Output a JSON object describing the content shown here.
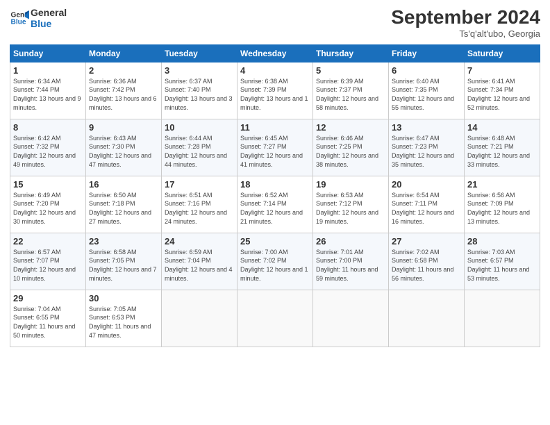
{
  "header": {
    "logo_line1": "General",
    "logo_line2": "Blue",
    "month": "September 2024",
    "location": "Ts'q'alt'ubo, Georgia"
  },
  "weekdays": [
    "Sunday",
    "Monday",
    "Tuesday",
    "Wednesday",
    "Thursday",
    "Friday",
    "Saturday"
  ],
  "weeks": [
    [
      {
        "day": "1",
        "sunrise": "6:34 AM",
        "sunset": "7:44 PM",
        "daylight": "13 hours and 9 minutes."
      },
      {
        "day": "2",
        "sunrise": "6:36 AM",
        "sunset": "7:42 PM",
        "daylight": "13 hours and 6 minutes."
      },
      {
        "day": "3",
        "sunrise": "6:37 AM",
        "sunset": "7:40 PM",
        "daylight": "13 hours and 3 minutes."
      },
      {
        "day": "4",
        "sunrise": "6:38 AM",
        "sunset": "7:39 PM",
        "daylight": "13 hours and 1 minute."
      },
      {
        "day": "5",
        "sunrise": "6:39 AM",
        "sunset": "7:37 PM",
        "daylight": "12 hours and 58 minutes."
      },
      {
        "day": "6",
        "sunrise": "6:40 AM",
        "sunset": "7:35 PM",
        "daylight": "12 hours and 55 minutes."
      },
      {
        "day": "7",
        "sunrise": "6:41 AM",
        "sunset": "7:34 PM",
        "daylight": "12 hours and 52 minutes."
      }
    ],
    [
      {
        "day": "8",
        "sunrise": "6:42 AM",
        "sunset": "7:32 PM",
        "daylight": "12 hours and 49 minutes."
      },
      {
        "day": "9",
        "sunrise": "6:43 AM",
        "sunset": "7:30 PM",
        "daylight": "12 hours and 47 minutes."
      },
      {
        "day": "10",
        "sunrise": "6:44 AM",
        "sunset": "7:28 PM",
        "daylight": "12 hours and 44 minutes."
      },
      {
        "day": "11",
        "sunrise": "6:45 AM",
        "sunset": "7:27 PM",
        "daylight": "12 hours and 41 minutes."
      },
      {
        "day": "12",
        "sunrise": "6:46 AM",
        "sunset": "7:25 PM",
        "daylight": "12 hours and 38 minutes."
      },
      {
        "day": "13",
        "sunrise": "6:47 AM",
        "sunset": "7:23 PM",
        "daylight": "12 hours and 35 minutes."
      },
      {
        "day": "14",
        "sunrise": "6:48 AM",
        "sunset": "7:21 PM",
        "daylight": "12 hours and 33 minutes."
      }
    ],
    [
      {
        "day": "15",
        "sunrise": "6:49 AM",
        "sunset": "7:20 PM",
        "daylight": "12 hours and 30 minutes."
      },
      {
        "day": "16",
        "sunrise": "6:50 AM",
        "sunset": "7:18 PM",
        "daylight": "12 hours and 27 minutes."
      },
      {
        "day": "17",
        "sunrise": "6:51 AM",
        "sunset": "7:16 PM",
        "daylight": "12 hours and 24 minutes."
      },
      {
        "day": "18",
        "sunrise": "6:52 AM",
        "sunset": "7:14 PM",
        "daylight": "12 hours and 21 minutes."
      },
      {
        "day": "19",
        "sunrise": "6:53 AM",
        "sunset": "7:12 PM",
        "daylight": "12 hours and 19 minutes."
      },
      {
        "day": "20",
        "sunrise": "6:54 AM",
        "sunset": "7:11 PM",
        "daylight": "12 hours and 16 minutes."
      },
      {
        "day": "21",
        "sunrise": "6:56 AM",
        "sunset": "7:09 PM",
        "daylight": "12 hours and 13 minutes."
      }
    ],
    [
      {
        "day": "22",
        "sunrise": "6:57 AM",
        "sunset": "7:07 PM",
        "daylight": "12 hours and 10 minutes."
      },
      {
        "day": "23",
        "sunrise": "6:58 AM",
        "sunset": "7:05 PM",
        "daylight": "12 hours and 7 minutes."
      },
      {
        "day": "24",
        "sunrise": "6:59 AM",
        "sunset": "7:04 PM",
        "daylight": "12 hours and 4 minutes."
      },
      {
        "day": "25",
        "sunrise": "7:00 AM",
        "sunset": "7:02 PM",
        "daylight": "12 hours and 1 minute."
      },
      {
        "day": "26",
        "sunrise": "7:01 AM",
        "sunset": "7:00 PM",
        "daylight": "11 hours and 59 minutes."
      },
      {
        "day": "27",
        "sunrise": "7:02 AM",
        "sunset": "6:58 PM",
        "daylight": "11 hours and 56 minutes."
      },
      {
        "day": "28",
        "sunrise": "7:03 AM",
        "sunset": "6:57 PM",
        "daylight": "11 hours and 53 minutes."
      }
    ],
    [
      {
        "day": "29",
        "sunrise": "7:04 AM",
        "sunset": "6:55 PM",
        "daylight": "11 hours and 50 minutes."
      },
      {
        "day": "30",
        "sunrise": "7:05 AM",
        "sunset": "6:53 PM",
        "daylight": "11 hours and 47 minutes."
      },
      null,
      null,
      null,
      null,
      null
    ]
  ],
  "labels": {
    "sunrise": "Sunrise:",
    "sunset": "Sunset:",
    "daylight": "Daylight:"
  }
}
